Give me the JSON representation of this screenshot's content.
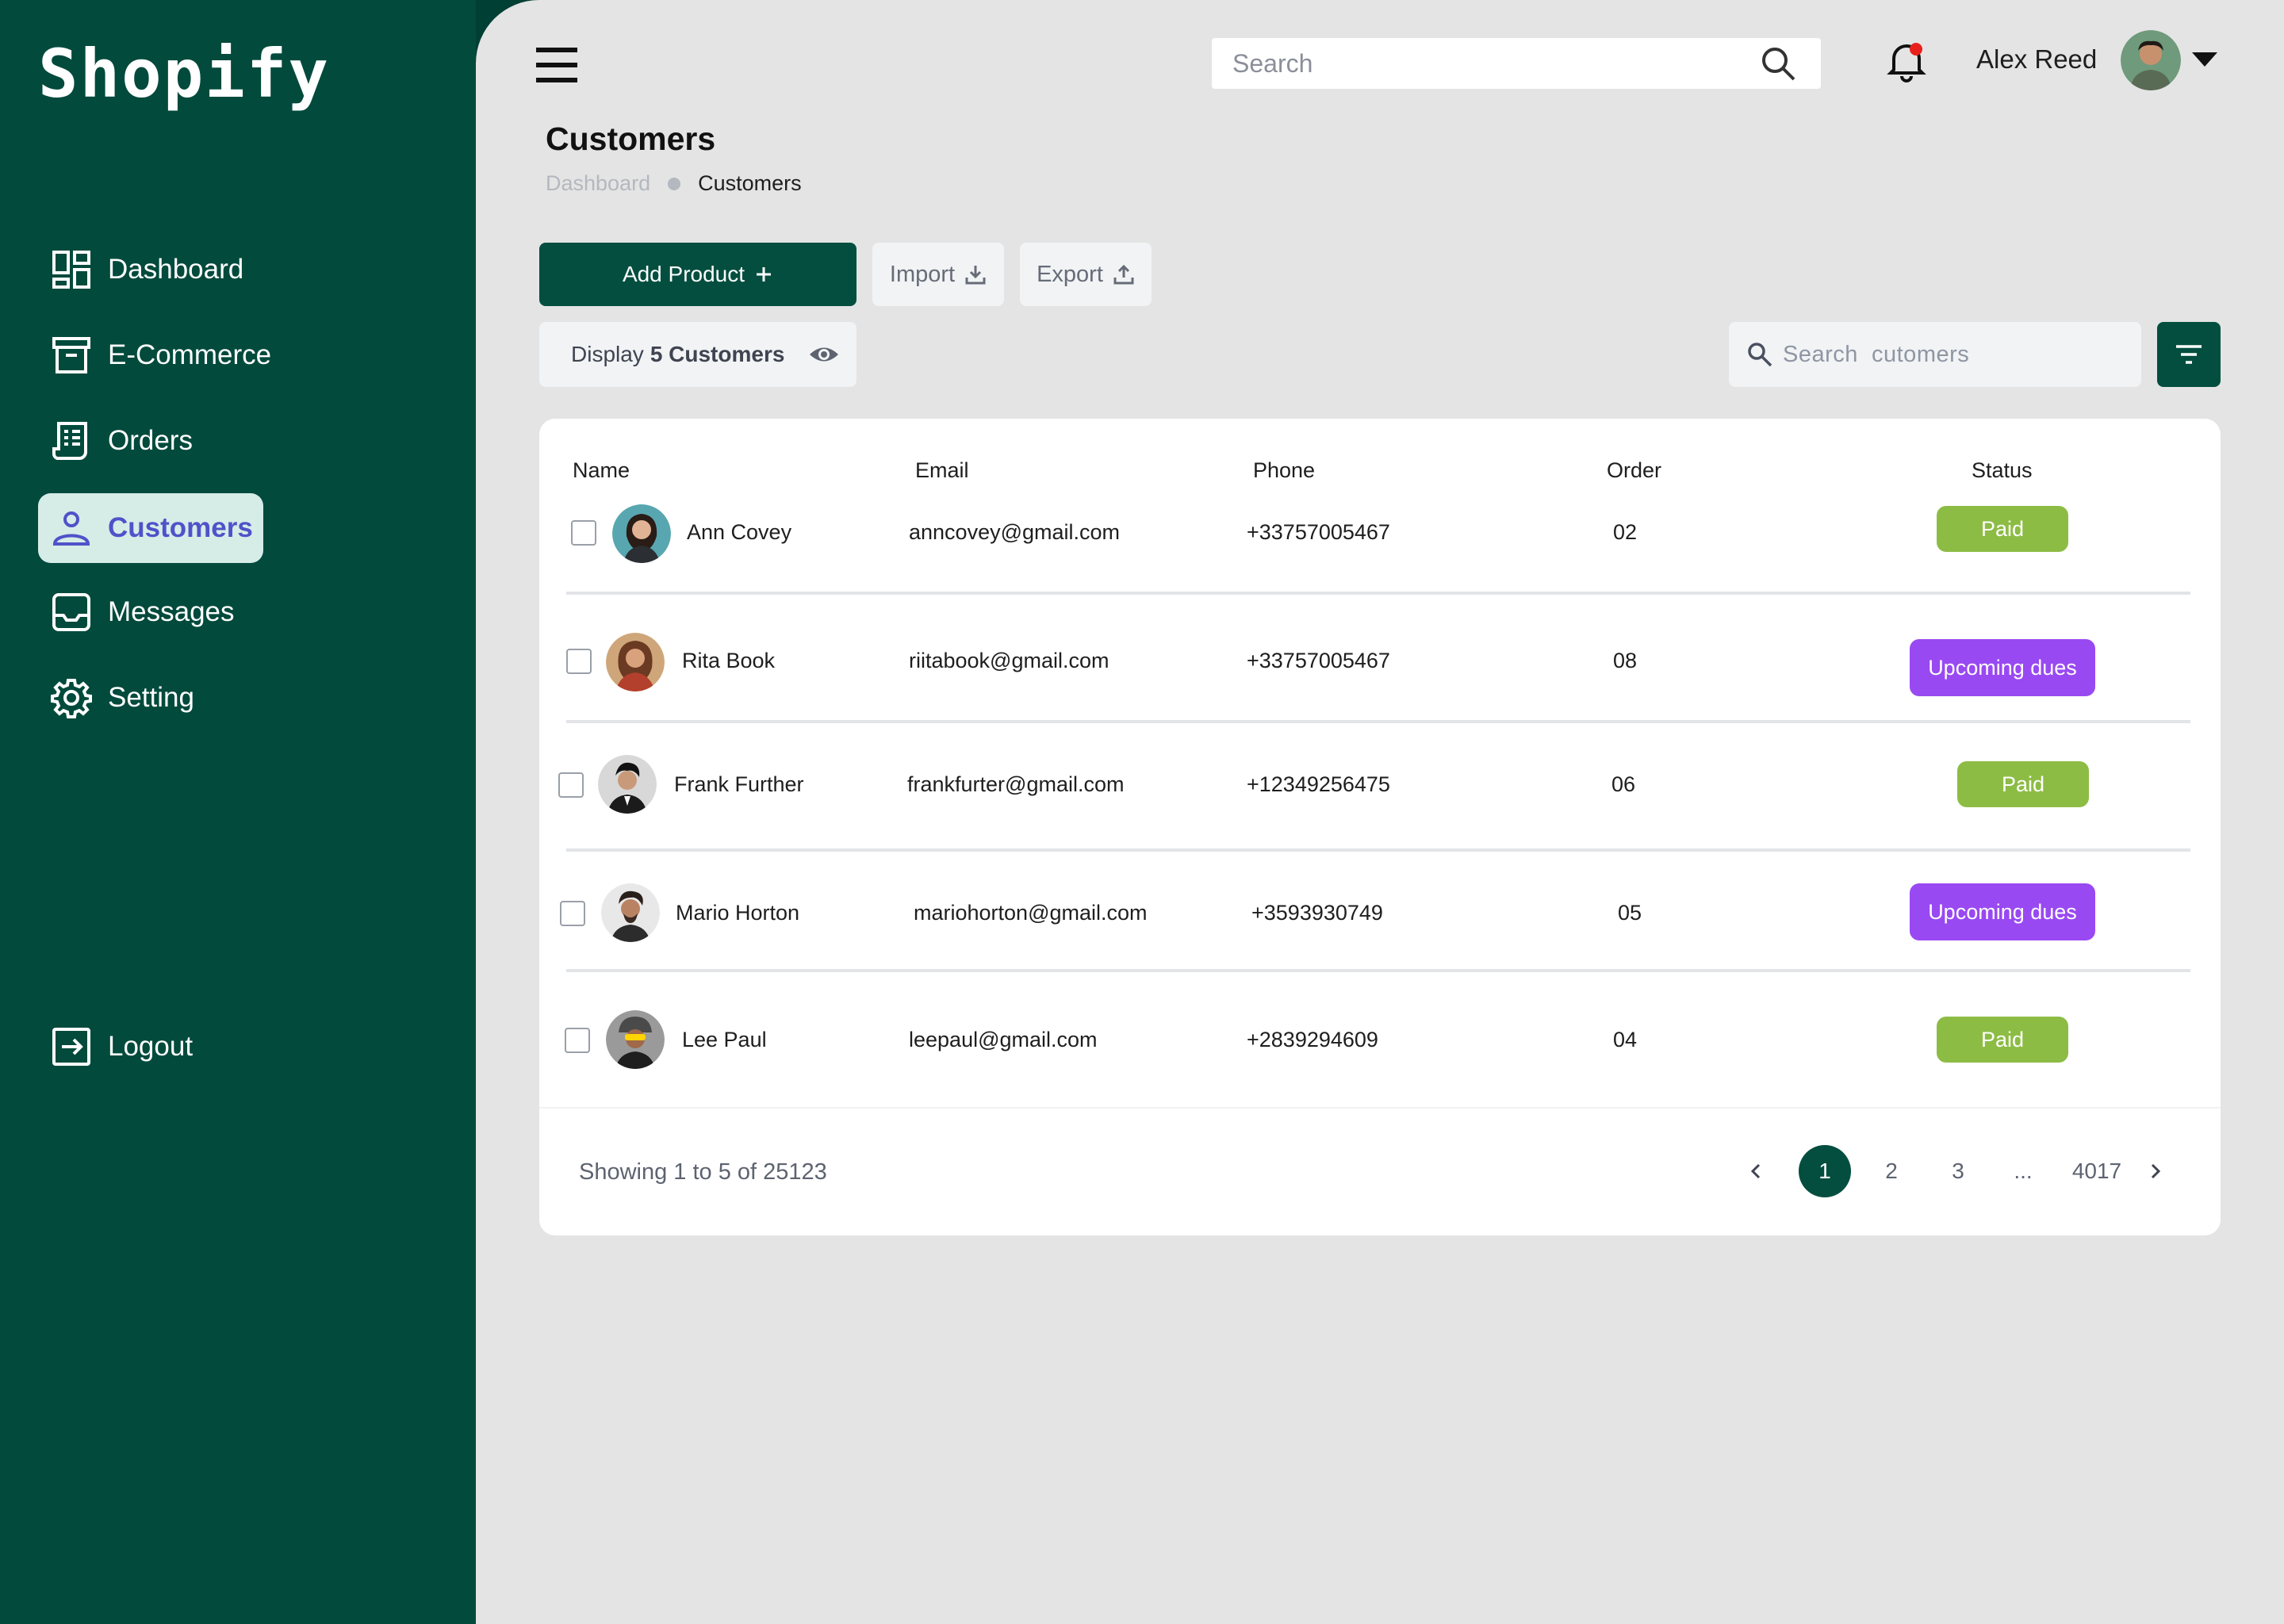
{
  "brand": {
    "name": "Shopify"
  },
  "sidebar": {
    "items": [
      {
        "label": "Dashboard",
        "icon": "dashboard-icon"
      },
      {
        "label": "E-Commerce",
        "icon": "archive-icon"
      },
      {
        "label": "Orders",
        "icon": "receipt-icon"
      },
      {
        "label": "Customers",
        "icon": "user-icon",
        "active": true
      },
      {
        "label": "Messages",
        "icon": "inbox-icon"
      },
      {
        "label": "Setting",
        "icon": "gear-icon"
      }
    ],
    "logout": {
      "label": "Logout",
      "icon": "logout-icon"
    }
  },
  "header": {
    "search_placeholder": "Search",
    "user_name": "Alex Reed"
  },
  "page": {
    "title": "Customers",
    "breadcrumb": [
      "Dashboard",
      "Customers"
    ]
  },
  "toolbar": {
    "add_label": "Add Product",
    "import_label": "Import",
    "export_label": "Export",
    "display_prefix": "Display",
    "display_value": "5 Customers",
    "search_placeholder": "Search  cutomers"
  },
  "table": {
    "columns": [
      "Name",
      "Email",
      "Phone",
      "Order",
      "Status"
    ],
    "rows": [
      {
        "name": "Ann Covey",
        "email": "anncovey@gmail.com",
        "phone": "+33757005467",
        "order": "02",
        "status": "Paid"
      },
      {
        "name": "Rita Book",
        "email": "riitabook@gmail.com",
        "phone": "+33757005467",
        "order": "08",
        "status": "Upcoming dues"
      },
      {
        "name": "Frank Further",
        "email": "frankfurter@gmail.com",
        "phone": "+12349256475",
        "order": "06",
        "status": "Paid"
      },
      {
        "name": "Mario Horton",
        "email": "mariohorton@gmail.com",
        "phone": "+3593930749",
        "order": "05",
        "status": "Upcoming dues"
      },
      {
        "name": "Lee Paul",
        "email": "leepaul@gmail.com",
        "phone": "+2839294609",
        "order": "04",
        "status": "Paid"
      }
    ]
  },
  "footer": {
    "showing": "Showing 1 to 5 of 25123",
    "pages": [
      "1",
      "2",
      "3",
      "...",
      "4017"
    ],
    "current_page": "1"
  },
  "colors": {
    "sidebar_bg": "#014a3c",
    "primary": "#034e3f",
    "paid": "#8dbc45",
    "dues": "#9949f2",
    "active_nav_text": "#4f52c9"
  }
}
